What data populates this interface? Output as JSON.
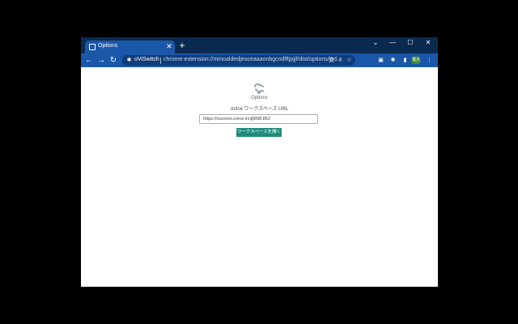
{
  "tab": {
    "title": "Options",
    "favicon_icon": "ovice-logo-icon",
    "close_symbol": "✕",
    "new_tab_symbol": "+"
  },
  "window_controls": {
    "tab_search": "⌄",
    "minimize": "—",
    "maximize": "☐",
    "close": "✕"
  },
  "nav": {
    "back": "←",
    "forward": "→",
    "reload": "↻"
  },
  "omnibox": {
    "extension_glyph": "✱",
    "extension_name": "oViSwitch",
    "url": "chrome-extension://mmoaldedjeoceaaaonbgcndlftjpjjf/dist/options/ind...",
    "translate_glyph": "文",
    "share_glyph": "⇪",
    "bookmark_glyph": "☆"
  },
  "toolbar": {
    "ext_glyph": "▣",
    "extensions_glyph": "✱",
    "sidepanel_glyph": "▮",
    "profile_label": "電大",
    "menu_glyph": "⋮"
  },
  "page": {
    "title": "Options",
    "field_label": "oVice ワークスペース URL",
    "url_value": "https://xxxxxxx.ovice.in/@898,862",
    "button_label": "ワークスペースを開く"
  },
  "colors": {
    "tabstrip": "#0b2a4f",
    "toolbar": "#1b57a8",
    "accent_button": "#1e8c7b"
  }
}
